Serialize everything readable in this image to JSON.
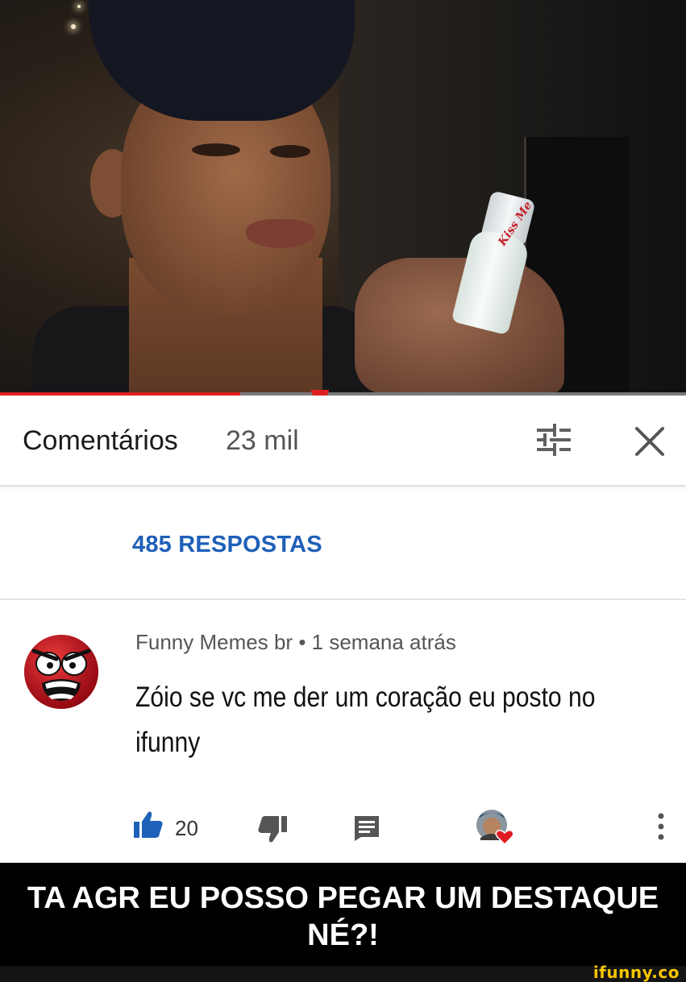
{
  "comments_header": {
    "title": "Comentários",
    "count": "23 mil",
    "sort_icon": "sort-sliders-icon",
    "close_icon": "close-icon"
  },
  "video": {
    "progress_fraction": 0.35,
    "bottle_label": "Kiss Me"
  },
  "replies": {
    "link_label": "485 RESPOSTAS"
  },
  "comment": {
    "author": "Funny Memes br",
    "separator": "•",
    "time": "1 semana atrás",
    "text": "Zóio se vc me der um coração eu posto no ifunny",
    "likes": "20",
    "icons": [
      "thumbs-up-icon",
      "thumbs-down-icon",
      "reply-icon",
      "creator-heart-icon",
      "more-vert-icon"
    ]
  },
  "caption": {
    "text": "TA AGR EU POSSO PEGAR UM DESTAQUE NÉ?!"
  },
  "watermark": "ifunny.co",
  "colors": {
    "accent_red": "#e02020",
    "link_blue": "#1f60b8",
    "watermark_yellow": "#f5c400"
  }
}
